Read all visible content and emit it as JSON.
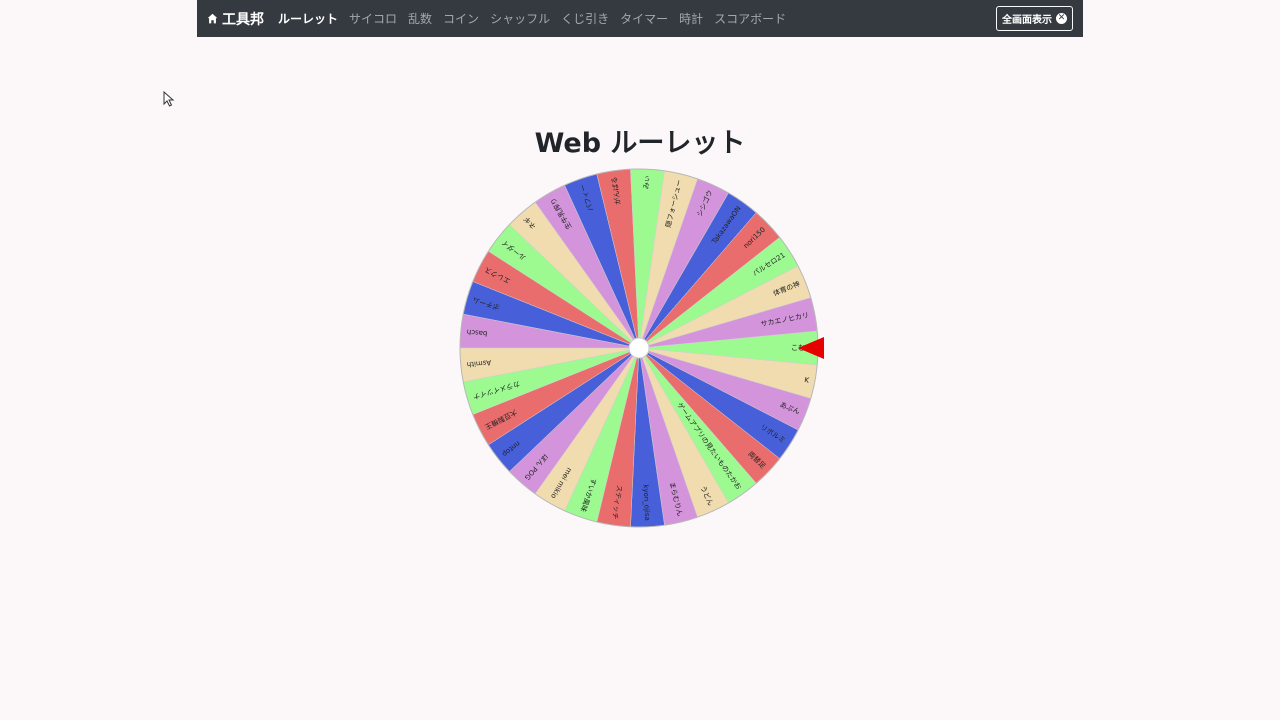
{
  "nav": {
    "brand": "工具邦",
    "links": [
      "ルーレット",
      "サイコロ",
      "乱数",
      "コイン",
      "シャッフル",
      "くじ引き",
      "タイマー",
      "時計",
      "スコアボード"
    ],
    "active_index": 0,
    "fullscreen_label": "全画面表示"
  },
  "page": {
    "title": "Web ルーレット"
  },
  "wheel": {
    "colors": [
      "#9cfa91",
      "#f0dcae",
      "#d494dc",
      "#4760da",
      "#ea6d6e"
    ],
    "pointer_color": "#e60000",
    "labels": [
      "こむぎ",
      "K",
      "あぷん",
      "リボルミ",
      "両替足",
      "ゲームアプリの見たいものたかお",
      "うどん",
      "まらむりん",
      "kyon_ojisa",
      "スティッチ",
      "すいか風味",
      "mei mikio",
      "ぼん POG",
      "nntop",
      "大豆製機王",
      "カラメイツイナ",
      "Asmith",
      "basch",
      "ポチーム",
      "エレクス",
      "ルーダイ",
      "ネギ",
      "生牛乳搾り",
      "パフィー",
      "がんばる",
      "みぃ",
      "隠フォーシュー",
      "シシゴウ",
      "TakazawaON",
      "nori150",
      "パルセロ21",
      "体育の神",
      "サカエノヒカリ"
    ]
  }
}
